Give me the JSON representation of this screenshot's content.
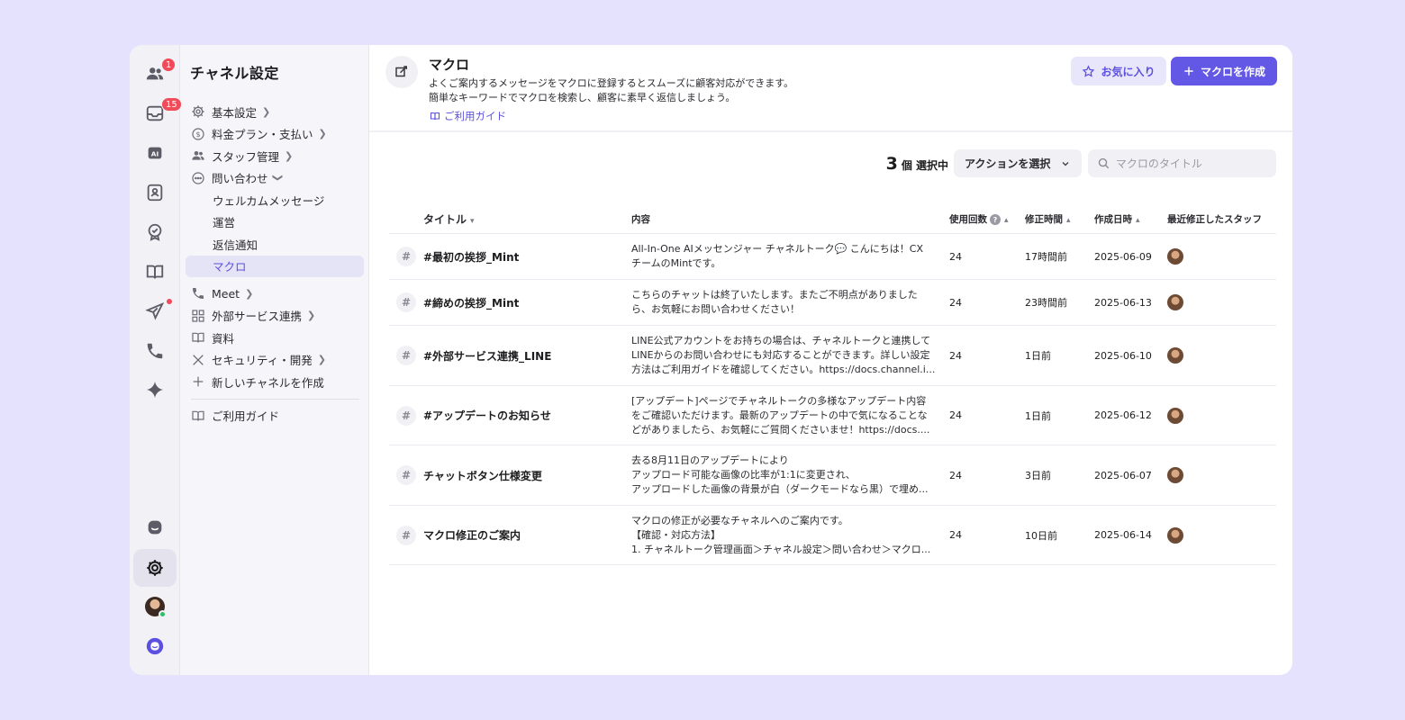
{
  "rail": {
    "badges": {
      "users": "1",
      "inbox": "15"
    }
  },
  "sidebar": {
    "title": "チャネル設定",
    "items": [
      {
        "label": "基本設定",
        "icon": "gear-icon"
      },
      {
        "label": "料金プラン・支払い",
        "icon": "dollar-icon"
      },
      {
        "label": "スタッフ管理",
        "icon": "users-icon"
      },
      {
        "label": "問い合わせ",
        "icon": "chat-icon"
      }
    ],
    "sub_items": [
      {
        "label": "ウェルカムメッセージ"
      },
      {
        "label": "運営"
      },
      {
        "label": "返信通知"
      },
      {
        "label": "マクロ"
      }
    ],
    "items2": [
      {
        "label": "Meet",
        "icon": "phone-icon"
      },
      {
        "label": "外部サービス連携",
        "icon": "grid-icon"
      },
      {
        "label": "資料",
        "icon": "book-icon"
      },
      {
        "label": "セキュリティ・開発",
        "icon": "tools-icon"
      },
      {
        "label": "新しいチャネルを作成",
        "icon": "plus-icon"
      }
    ],
    "guide": "ご利用ガイド"
  },
  "header": {
    "title": "マクロ",
    "desc1": "よくご案内するメッセージをマクロに登録するとスムーズに顧客対応ができます。",
    "desc2": "簡単なキーワードでマクロを検索し、顧客に素早く返信しましょう。",
    "guide": "ご利用ガイド",
    "fav_label": "お気に入り",
    "create_label": "マクロを作成"
  },
  "toolbar": {
    "count": "3",
    "count_suffix": "個 選択中",
    "action_label": "アクションを選択",
    "search_placeholder": "マクロのタイトル"
  },
  "table": {
    "headers": {
      "title": "タイトル",
      "content": "内容",
      "uses": "使用回数",
      "modified": "修正時間",
      "created": "作成日時",
      "staff": "最近修正したスタッフ"
    },
    "rows": [
      {
        "title": "#最初の挨拶_Mint",
        "content": [
          "All-In-One AIメッセンジャー チャネルトーク💬 こんにちは！CX",
          "チームのMintです。"
        ],
        "uses": "24",
        "modified": "17時間前",
        "created": "2025-06-09"
      },
      {
        "title": "#締めの挨拶_Mint",
        "content": [
          "こちらのチャットは終了いたします。またご不明点がありました",
          "ら、お気軽にお問い合わせください！"
        ],
        "uses": "24",
        "modified": "23時間前",
        "created": "2025-06-13"
      },
      {
        "title": "#外部サービス連携_LINE",
        "content": [
          "LINE公式アカウントをお持ちの場合は、チャネルトークと連携して",
          "LINEからのお問い合わせにも対応することができます。詳しい設定",
          "方法はご利用ガイドを確認してください。https://docs.channel.i..."
        ],
        "uses": "24",
        "modified": "1日前",
        "created": "2025-06-10"
      },
      {
        "title": "#アップデートのお知らせ",
        "content": [
          "[アップデート]ページでチャネルトークの多様なアップデート内容",
          "をご確認いただけます。最新のアップデートの中で気になることな",
          "どがありましたら、お気軽にご質問くださいませ！https://docs...."
        ],
        "uses": "24",
        "modified": "1日前",
        "created": "2025-06-12"
      },
      {
        "title": "チャットボタン仕様変更",
        "content": [
          "去る8月11日のアップデートにより",
          "アップロード可能な画像の比率が1:1に変更され、",
          "アップロードした画像の背景が白（ダークモードなら黒）で埋め..."
        ],
        "uses": "24",
        "modified": "3日前",
        "created": "2025-06-07"
      },
      {
        "title": "マクロ修正のご案内",
        "content": [
          "マクロの修正が必要なチャネルへのご案内です。",
          "【確認・対応方法】",
          "1. チャネルトーク管理画面＞チャネル設定＞問い合わせ＞マクロ..."
        ],
        "uses": "24",
        "modified": "10日前",
        "created": "2025-06-14"
      }
    ]
  },
  "colors": {
    "accent": "#6357e6",
    "badge": "#ef4b59",
    "bg": "#e4e2fd"
  }
}
